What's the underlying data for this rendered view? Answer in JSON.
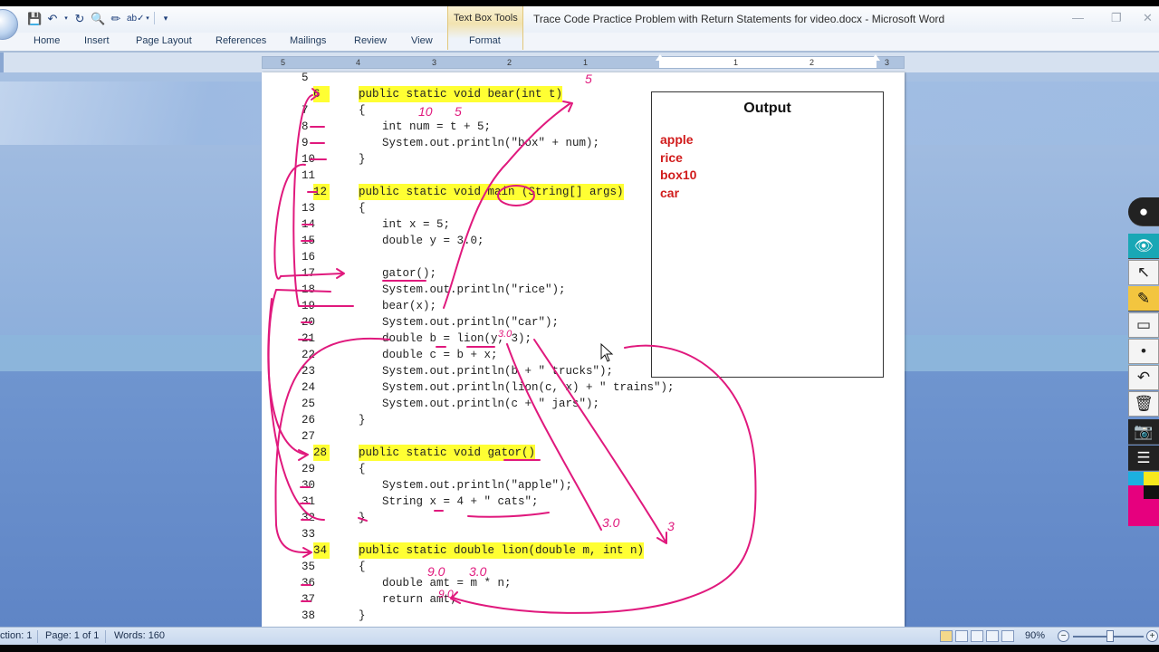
{
  "window": {
    "title": "Trace Code Practice Problem with Return Statements for video.docx - Microsoft Word",
    "contextual_tab_group": "Text Box Tools",
    "controls": {
      "minimize": "—",
      "restore": "❐",
      "close": "✕"
    }
  },
  "quick_access": {
    "icons": [
      "save-icon",
      "undo-icon",
      "redo-icon",
      "print-preview-icon",
      "format-painter-icon",
      "spelling-icon",
      "customize-icon"
    ]
  },
  "ribbon": {
    "tabs": [
      {
        "label": "Home"
      },
      {
        "label": "Insert"
      },
      {
        "label": "Page Layout"
      },
      {
        "label": "References"
      },
      {
        "label": "Mailings"
      },
      {
        "label": "Review"
      },
      {
        "label": "View"
      },
      {
        "label": "Format"
      }
    ]
  },
  "ruler": {
    "numbers": [
      "5",
      "4",
      "3",
      "2",
      "1",
      "1",
      "2",
      "3"
    ]
  },
  "document": {
    "lines": [
      {
        "num": "5",
        "text": "",
        "highlight": false,
        "indent": 0
      },
      {
        "num": "6",
        "text": "public static void bear(int t)",
        "highlight": true,
        "indent": 0
      },
      {
        "num": "7",
        "text": "{",
        "highlight": false,
        "indent": 0
      },
      {
        "num": "8",
        "text": "int num = t + 5;",
        "highlight": false,
        "indent": 1
      },
      {
        "num": "9",
        "text": "System.out.println(\"box\" + num);",
        "highlight": false,
        "indent": 1
      },
      {
        "num": "10",
        "text": "}",
        "highlight": false,
        "indent": 0
      },
      {
        "num": "11",
        "text": "",
        "highlight": false,
        "indent": 0
      },
      {
        "num": "12",
        "text": "public static void main (String[] args)",
        "highlight": true,
        "indent": 0
      },
      {
        "num": "13",
        "text": "{",
        "highlight": false,
        "indent": 0
      },
      {
        "num": "14",
        "text": "int x = 5;",
        "highlight": false,
        "indent": 1
      },
      {
        "num": "15",
        "text": "double y = 3.0;",
        "highlight": false,
        "indent": 1
      },
      {
        "num": "16",
        "text": "",
        "highlight": false,
        "indent": 0
      },
      {
        "num": "17",
        "text": "gator();",
        "highlight": false,
        "indent": 1
      },
      {
        "num": "18",
        "text": "System.out.println(\"rice\");",
        "highlight": false,
        "indent": 1
      },
      {
        "num": "19",
        "text": "bear(x);",
        "highlight": false,
        "indent": 1
      },
      {
        "num": "20",
        "text": "System.out.println(\"car\");",
        "highlight": false,
        "indent": 1
      },
      {
        "num": "21",
        "text": "double b = lion(y, 3);",
        "highlight": false,
        "indent": 1
      },
      {
        "num": "22",
        "text": "double c = b + x;",
        "highlight": false,
        "indent": 1
      },
      {
        "num": "23",
        "text": "System.out.println(b + \" trucks\");",
        "highlight": false,
        "indent": 1
      },
      {
        "num": "24",
        "text": "System.out.println(lion(c, x) + \" trains\");",
        "highlight": false,
        "indent": 1
      },
      {
        "num": "25",
        "text": "System.out.println(c + \" jars\");",
        "highlight": false,
        "indent": 1
      },
      {
        "num": "26",
        "text": "}",
        "highlight": false,
        "indent": 0
      },
      {
        "num": "27",
        "text": "",
        "highlight": false,
        "indent": 0
      },
      {
        "num": "28",
        "text": "public static void gator()",
        "highlight": true,
        "indent": 0
      },
      {
        "num": "29",
        "text": "{",
        "highlight": false,
        "indent": 0
      },
      {
        "num": "30",
        "text": "System.out.println(\"apple\");",
        "highlight": false,
        "indent": 1
      },
      {
        "num": "31",
        "text": "String x = 4 + \" cats\";",
        "highlight": false,
        "indent": 1
      },
      {
        "num": "32",
        "text": "}",
        "highlight": false,
        "indent": 0
      },
      {
        "num": "33",
        "text": "",
        "highlight": false,
        "indent": 0
      },
      {
        "num": "34",
        "text": "public static double lion(double m, int n)",
        "highlight": true,
        "indent": 0
      },
      {
        "num": "35",
        "text": "{",
        "highlight": false,
        "indent": 0
      },
      {
        "num": "36",
        "text": "double amt = m * n;",
        "highlight": false,
        "indent": 1
      },
      {
        "num": "37",
        "text": "return amt;",
        "highlight": false,
        "indent": 1
      },
      {
        "num": "38",
        "text": "}",
        "highlight": false,
        "indent": 0
      }
    ],
    "output_box": {
      "title": "Output",
      "lines": [
        "apple",
        "rice",
        "box10",
        "car"
      ]
    },
    "annotations": {
      "ink_color": "#e0197d",
      "notes": [
        "5",
        "10",
        "5",
        "3.0",
        "3.0",
        "9.0",
        "3.0",
        "9.0",
        "3"
      ]
    }
  },
  "annotation_toolbar": {
    "tools": [
      "pen-logo-icon",
      "eye-icon",
      "pointer-icon",
      "highlighter-icon",
      "eraser-icon",
      "dot-icon",
      "undo-icon",
      "trash-icon",
      "camera-icon",
      "notes-icon",
      "color-palette-icon"
    ]
  },
  "statusbar": {
    "section": "ction: 1",
    "page": "Page: 1 of 1",
    "words": "Words: 160",
    "zoom": "90%",
    "zoom_out": "−",
    "zoom_in": "+"
  }
}
